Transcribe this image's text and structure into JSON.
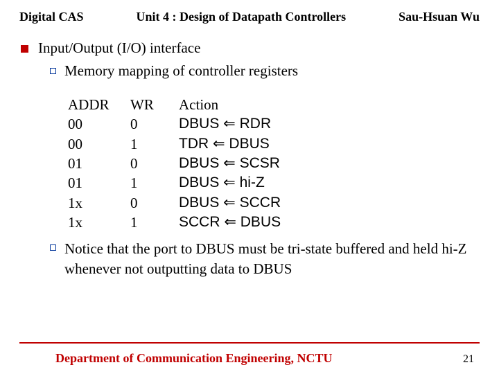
{
  "header": {
    "left": "Digital CAS",
    "center": "Unit 4 : Design of Datapath Controllers",
    "right": "Sau-Hsuan Wu"
  },
  "bullets": {
    "main": "Input/Output (I/O) interface",
    "sub1": "Memory mapping of controller registers",
    "notice": "Notice that the port to DBUS must be tri-state buffered and held hi-Z whenever not outputting data to DBUS"
  },
  "table": {
    "head": {
      "addr": "ADDR",
      "wr": "WR",
      "action": "Action"
    },
    "rows": [
      {
        "addr": "00",
        "wr": "0",
        "action": "DBUS ⇐ RDR"
      },
      {
        "addr": "00",
        "wr": "1",
        "action": "TDR ⇐ DBUS"
      },
      {
        "addr": "01",
        "wr": "0",
        "action": "DBUS ⇐ SCSR"
      },
      {
        "addr": "01",
        "wr": "1",
        "action": "DBUS ⇐ hi-Z"
      },
      {
        "addr": "1x",
        "wr": "0",
        "action": "DBUS ⇐ SCCR"
      },
      {
        "addr": "1x",
        "wr": "1",
        "action": "SCCR ⇐ DBUS"
      }
    ]
  },
  "footer": {
    "dept": "Department of Communication Engineering, NCTU",
    "page": "21"
  }
}
